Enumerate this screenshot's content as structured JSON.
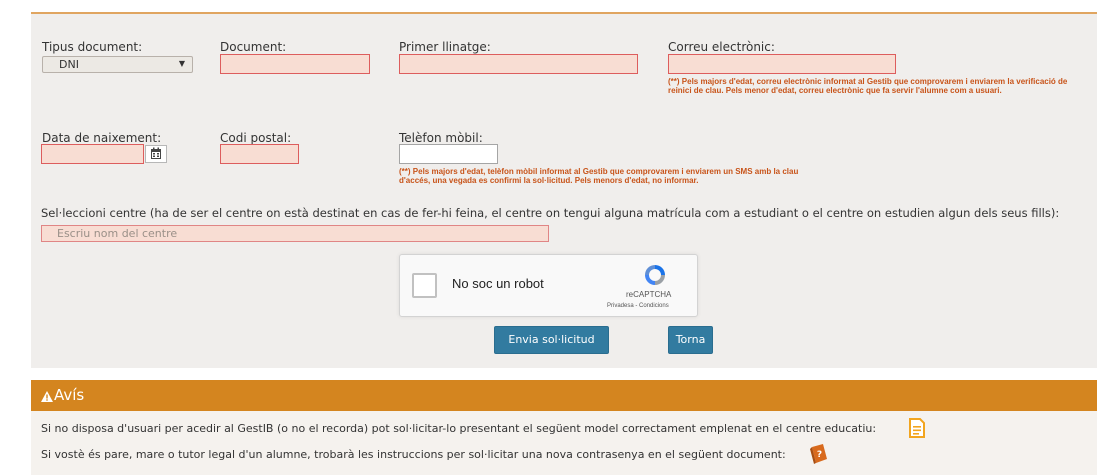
{
  "form": {
    "tipus_document": {
      "label": "Tipus document:",
      "value": "DNI"
    },
    "document": {
      "label": "Document:",
      "value": ""
    },
    "primer_llinatge": {
      "label": "Primer llinatge:",
      "value": ""
    },
    "correu": {
      "label": "Correu electrònic:",
      "value": "",
      "note": "(**) Pels majors d'edat, correu electrònic informat al Gestib que comprovarem i enviarem la verificació de reinici de clau. Pels menor d'edat, correu electrònic que fa servir l'alumne com a usuari."
    },
    "data_naixement": {
      "label": "Data de naixement:",
      "value": ""
    },
    "codi_postal": {
      "label": "Codi postal:",
      "value": ""
    },
    "telefon": {
      "label": "Telèfon mòbil:",
      "value": "",
      "note": "(**) Pels majors d'edat, telèfon mòbil informat al Gestib que comprovarem i enviarem un SMS amb la clau d'accés, una vegada es confirmi la sol·licitud. Pels menors d'edat, no informar."
    },
    "centre": {
      "label": "Sel·leccioni centre (ha de ser el centre on està destinat en cas de fer-hi feina, el centre on tengui alguna matrícula com a estudiant o el centre on estudien algun dels seus fills):",
      "placeholder": "Escriu nom del centre"
    }
  },
  "captcha": {
    "label": "No soc un robot",
    "brand": "reCAPTCHA",
    "links": "Privadesa - Condicions"
  },
  "buttons": {
    "submit": "Envia sol·licitud",
    "back": "Torna"
  },
  "avis": {
    "title": "Avís",
    "line1": "Si no disposa d'usuari per acedir al GestIB (o no el recorda) pot sol·licitar-lo presentant el següent model correctament emplenat en el centre educatiu:",
    "line2": "Si vostè és pare, mare o tutor legal d'un alumne, trobarà les instruccions per sol·licitar una nova contrasenya en el següent document:"
  },
  "icons": {
    "calendar": "calendar-icon",
    "warning": "warning-icon",
    "document": "document-icon",
    "help_book": "help-book-icon"
  },
  "colors": {
    "panel_bg": "#f0eeec",
    "required_field_bg": "#f8ddd3",
    "required_field_border": "#dd5d5d",
    "note_text": "#c8541a",
    "button": "#327ba0",
    "warning_header": "#d4851f"
  }
}
